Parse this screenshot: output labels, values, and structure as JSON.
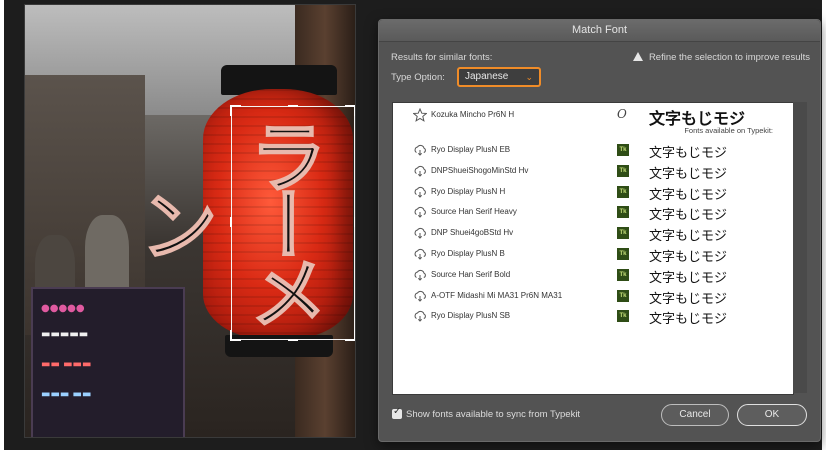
{
  "dialog": {
    "title": "Match Font",
    "results_label": "Results for similar fonts:",
    "refine_hint": "Refine the selection to improve results",
    "type_option_label": "Type Option:",
    "type_option_value": "Japanese",
    "typekit_header": "Fonts available on Typekit:",
    "installed_font": {
      "name": "Kozuka Mincho Pr6N H",
      "format_glyph": "O",
      "preview": "文字もじモジ",
      "icon": "star-icon"
    },
    "typekit_fonts": [
      {
        "name": "Ryo Display PlusN EB",
        "badge": "Tk",
        "preview": "文字もじモジ",
        "icon": "cloud-sync-icon"
      },
      {
        "name": "DNPShueiShogoMinStd Hv",
        "badge": "Tk",
        "preview": "文字もじモジ",
        "icon": "cloud-sync-icon"
      },
      {
        "name": "Ryo Display PlusN H",
        "badge": "Tk",
        "preview": "文字もじモジ",
        "icon": "cloud-sync-icon"
      },
      {
        "name": "Source Han Serif Heavy",
        "badge": "Tk",
        "preview": "文字もじモジ",
        "icon": "cloud-sync-icon"
      },
      {
        "name": "DNP Shuei4goBStd Hv",
        "badge": "Tk",
        "preview": "文字もじモジ",
        "icon": "cloud-sync-icon"
      },
      {
        "name": "Ryo Display PlusN B",
        "badge": "Tk",
        "preview": "文字もじモジ",
        "icon": "cloud-sync-icon"
      },
      {
        "name": "Source Han Serif Bold",
        "badge": "Tk",
        "preview": "文字もじモジ",
        "icon": "cloud-sync-icon"
      },
      {
        "name": "A-OTF Midashi Mi MA31 Pr6N MA31",
        "badge": "Tk",
        "preview": "文字もじモジ",
        "icon": "cloud-sync-icon"
      },
      {
        "name": "Ryo Display PlusN SB",
        "badge": "Tk",
        "preview": "文字もじモジ",
        "icon": "cloud-sync-icon"
      }
    ],
    "show_typekit_checkbox": {
      "label": "Show fonts available to sync from Typekit",
      "checked": true
    },
    "cancel_label": "Cancel",
    "ok_label": "OK"
  },
  "photo": {
    "lantern_text": "ラーメン"
  },
  "colors": {
    "dialog_bg": "#535353",
    "accent": "#f08c28",
    "typekit_badge": "#2f4d16"
  }
}
